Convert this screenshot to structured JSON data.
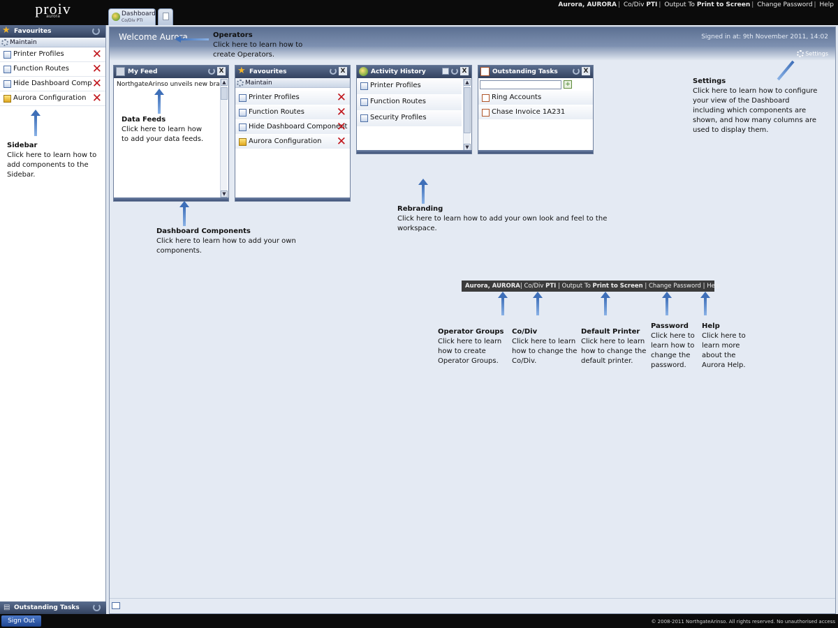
{
  "brand": {
    "logo": "proiv",
    "sublogo": "aurora"
  },
  "topnav": {
    "user": "Aurora, AURORA",
    "codiv_label": "Co/Div",
    "codiv_value": "PTI",
    "output_label": "Output To",
    "output_value": "Print to Screen",
    "change_password": "Change Password",
    "help": "Help"
  },
  "tabs": {
    "dashboard_label": "Dashboard",
    "dashboard_sub": "Co/Div PTI"
  },
  "sidebar": {
    "favourites_title": "Favourites",
    "maintain_label": "Maintain",
    "items": [
      {
        "label": "Printer Profiles",
        "icon": "profile-icon"
      },
      {
        "label": "Function Routes",
        "icon": "profile-icon"
      },
      {
        "label": "Hide Dashboard Compon...",
        "icon": "profile-icon"
      },
      {
        "label": "Aurora Configuration",
        "icon": "folder-icon"
      }
    ],
    "outstanding_title": "Outstanding Tasks"
  },
  "main": {
    "welcome": "Welcome Aurora",
    "signed_in": "Signed in at: 9th November 2011, 14:02",
    "settings": "Settings"
  },
  "widgets": {
    "myfeed": {
      "title": "My Feed",
      "items": [
        "NorthgateArinso unveils new bra..."
      ]
    },
    "favourites": {
      "title": "Favourites",
      "maintain": "Maintain",
      "items": [
        "Printer Profiles",
        "Function Routes",
        "Hide Dashboard Component",
        "Aurora Configuration"
      ]
    },
    "activity": {
      "title": "Activity History",
      "items": [
        "Printer Profiles",
        "Function Routes",
        "Security Profiles"
      ]
    },
    "tasks": {
      "title": "Outstanding Tasks",
      "search_value": "",
      "items": [
        "Ring Accounts",
        "Chase Invoice 1A231"
      ]
    }
  },
  "annotations": {
    "operators": {
      "title": "Operators",
      "body1": "Click here to learn how to",
      "body2": "create Operators."
    },
    "datafeeds": {
      "title": "Data Feeds",
      "body1": "Click here to learn how",
      "body2": "to add your data feeds."
    },
    "sidebar": {
      "title": "Sidebar",
      "body1": "Click here to learn how to",
      "body2": "add components to the",
      "body3": "Sidebar."
    },
    "components": {
      "title": "Dashboard Components",
      "body1": "Click here to learn how to add your own",
      "body2": "components."
    },
    "rebranding": {
      "title": "Rebranding",
      "body1": "Click here to learn how to add your own look and feel to the",
      "body2": "workspace."
    },
    "settings": {
      "title": "Settings",
      "body1": "Click here to learn how to configure",
      "body2": "your view of the Dashboard",
      "body3": "including which components are",
      "body4": "shown, and how many columns are",
      "body5": "used to display them."
    },
    "opgroups": {
      "title": "Operator Groups",
      "body1": "Click here to learn",
      "body2": "how to create",
      "body3": "Operator Groups."
    },
    "codiv": {
      "title": "Co/Div",
      "body1": "Click here to learn",
      "body2": "how to change the",
      "body3": "Co/Div."
    },
    "printer": {
      "title": "Default Printer",
      "body1": "Click here to learn",
      "body2": "how to change the",
      "body3": "default printer."
    },
    "password": {
      "title": "Password",
      "body1": "Click here to",
      "body2": "learn how to",
      "body3": "change the",
      "body4": "password."
    },
    "help": {
      "title": "Help",
      "body1": "Click here to",
      "body2": "learn more",
      "body3": "about the",
      "body4": "Aurora Help."
    }
  },
  "infobar": {
    "user": "Aurora, AURORA",
    "codiv_label": "Co/Div",
    "codiv_value": "PTI",
    "output_label": "Output To",
    "output_value": "Print to Screen",
    "change_password": "Change Password",
    "help": "Help"
  },
  "footer": {
    "signout": "Sign Out",
    "copyright": "© 2008-2011 NorthgateArinso. All rights reserved. No unauthorised access"
  },
  "colors": {
    "accent_blue": "#3e6fb8",
    "delete_red": "#c0151b",
    "header_dark": "#33425f"
  }
}
